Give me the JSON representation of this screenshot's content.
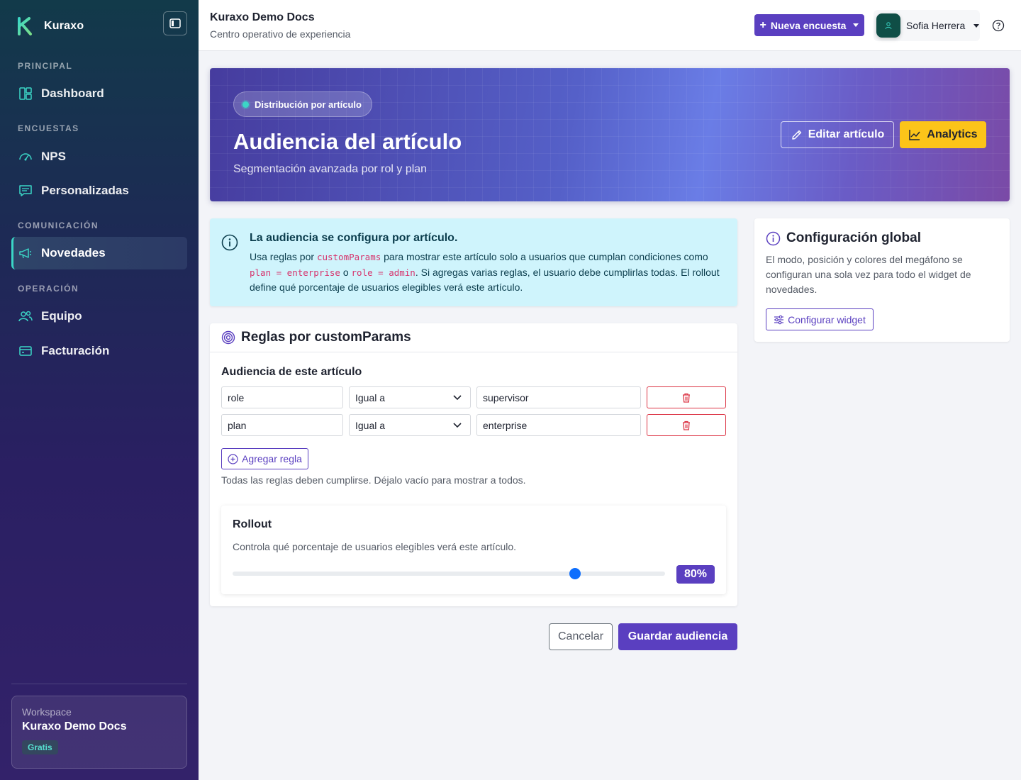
{
  "sidebar": {
    "brand": "Kuraxo",
    "sections": {
      "principal": "PRINCIPAL",
      "encuestas": "ENCUESTAS",
      "comunicacion": "COMUNICACIÓN",
      "operacion": "OPERACIÓN"
    },
    "items": {
      "dashboard": "Dashboard",
      "nps": "NPS",
      "personalizadas": "Personalizadas",
      "novedades": "Novedades",
      "equipo": "Equipo",
      "facturacion": "Facturación"
    },
    "active_item": "Novedades",
    "workspace": {
      "label": "Workspace",
      "name": "Kuraxo Demo Docs",
      "plan": "Gratis"
    }
  },
  "topbar": {
    "title": "Kuraxo Demo Docs",
    "subtitle": "Centro operativo de experiencia",
    "new_survey": "Nueva encuesta",
    "user_name": "Sofia Herrera"
  },
  "hero": {
    "badge": "Distribución por artículo",
    "title": "Audiencia del artículo",
    "subtitle": "Segmentación avanzada por rol y plan",
    "edit_button": "Editar artículo",
    "analytics_button": "Analytics"
  },
  "info": {
    "title": "La audiencia se configura por artículo.",
    "text_1": "Usa reglas por ",
    "code_1": "customParams",
    "text_2": " para mostrar este artículo solo a usuarios que cumplan condiciones como ",
    "code_2": "plan = enterprise",
    "text_3": " o ",
    "code_3": "role = admin",
    "text_4": ". Si agregas varias reglas, el usuario debe cumplirlas todas. El rollout define qué porcentaje de usuarios elegibles verá este artículo."
  },
  "rules": {
    "title": "Reglas por customParams",
    "audience_label": "Audiencia de este artículo",
    "rows": [
      {
        "param": "role",
        "operator": "Igual a",
        "value": "supervisor"
      },
      {
        "param": "plan",
        "operator": "Igual a",
        "value": "enterprise"
      }
    ],
    "add_rule": "Agregar regla",
    "hint": "Todas las reglas deben cumplirse. Déjalo vacío para mostrar a todos."
  },
  "rollout": {
    "title": "Rollout",
    "description": "Controla qué porcentaje de usuarios elegibles verá este artículo.",
    "value": 80,
    "value_label": "80%"
  },
  "actions": {
    "cancel": "Cancelar",
    "save": "Guardar audiencia"
  },
  "global_config": {
    "title": "Configuración global",
    "description": "El modo, posición y colores del megáfono se configuran una sola vez para todo el widget de novedades.",
    "button": "Configurar widget"
  },
  "colors": {
    "primary": "#5a3fc0",
    "accent_teal": "#3bd6c6",
    "warning": "#fcc419",
    "danger": "#dc3545",
    "info_bg": "#cff4fc"
  }
}
